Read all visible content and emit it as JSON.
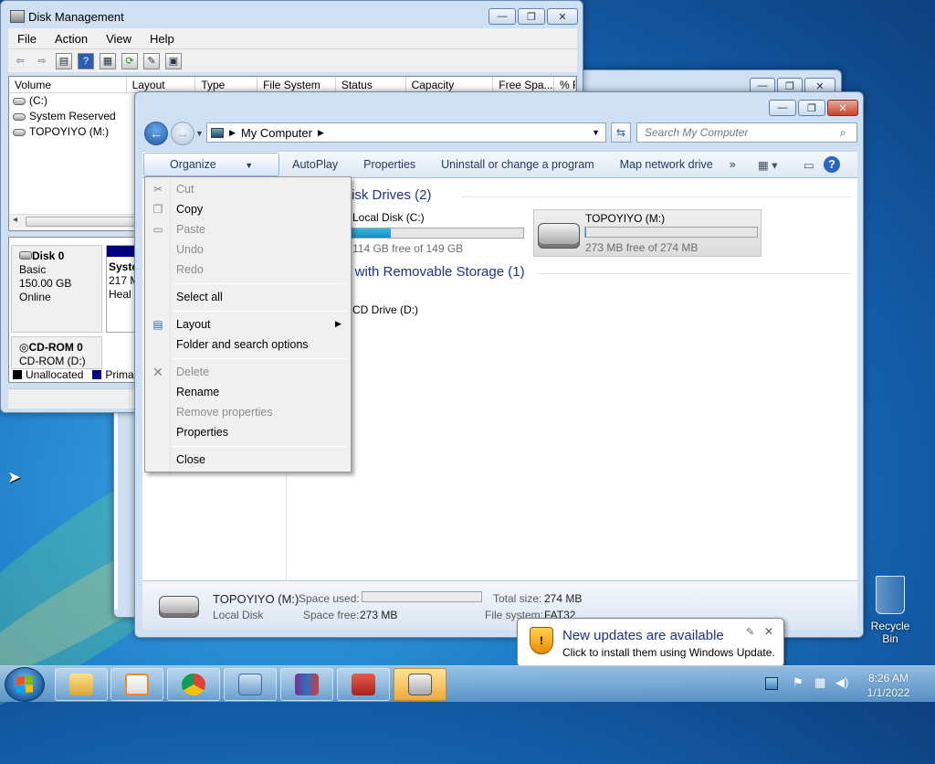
{
  "disk_management": {
    "title": "Disk Management",
    "menu": [
      "File",
      "Action",
      "View",
      "Help"
    ],
    "columns": [
      "Volume",
      "Layout",
      "Type",
      "File System",
      "Status",
      "Capacity",
      "Free Spa...",
      "% F"
    ],
    "volumes": [
      "(C:)",
      "System Reserved",
      "TOPOYIYO (M:)"
    ],
    "disk0": {
      "name": "Disk 0",
      "type": "Basic",
      "size": "150.00 GB",
      "state": "Online"
    },
    "disk0_partition": {
      "name": "Syste",
      "size": "217 M",
      "status": "Heal"
    },
    "cdrom0": {
      "name": "CD-ROM 0",
      "drive": "CD-ROM (D:)"
    },
    "legend": [
      "Unallocated",
      "Prima"
    ]
  },
  "explorer": {
    "address": "My Computer",
    "search_placeholder": "Search My Computer",
    "commands": [
      "Organize",
      "AutoPlay",
      "Properties",
      "Uninstall or change a program",
      "Map network drive",
      "»"
    ],
    "group_hard_disk": "isk Drives (2)",
    "group_removable": "s with Removable Storage (1)",
    "drive_c": {
      "name": "Local Disk (C:)",
      "free": "114 GB free of 149 GB",
      "used_fraction": 0.23
    },
    "drive_m": {
      "name": "TOPOYIYO (M:)",
      "free": "273 MB free of 274 MB",
      "used_fraction": 0.004
    },
    "drive_d": {
      "name": "CD Drive (D:)"
    },
    "details": {
      "name": "TOPOYIYO (M:)",
      "type": "Local Disk",
      "space_used_label": "Space used:",
      "space_free_label": "Space free:",
      "space_free": "273 MB",
      "total_size_label": "Total size:",
      "total_size": "274 MB",
      "file_system_label": "File system:",
      "file_system": "FAT32"
    }
  },
  "organize_menu": {
    "cut": "Cut",
    "copy": "Copy",
    "paste": "Paste",
    "undo": "Undo",
    "redo": "Redo",
    "select_all": "Select all",
    "layout": "Layout",
    "folder_options": "Folder and search options",
    "delete": "Delete",
    "rename": "Rename",
    "remove_properties": "Remove properties",
    "properties": "Properties",
    "close": "Close"
  },
  "notification": {
    "title": "New updates are available",
    "body": "Click to install them using Windows Update."
  },
  "desktop": {
    "recycle_bin": "Recycle Bin"
  },
  "clock": {
    "time": "8:26 AM",
    "date": "1/1/2022"
  }
}
